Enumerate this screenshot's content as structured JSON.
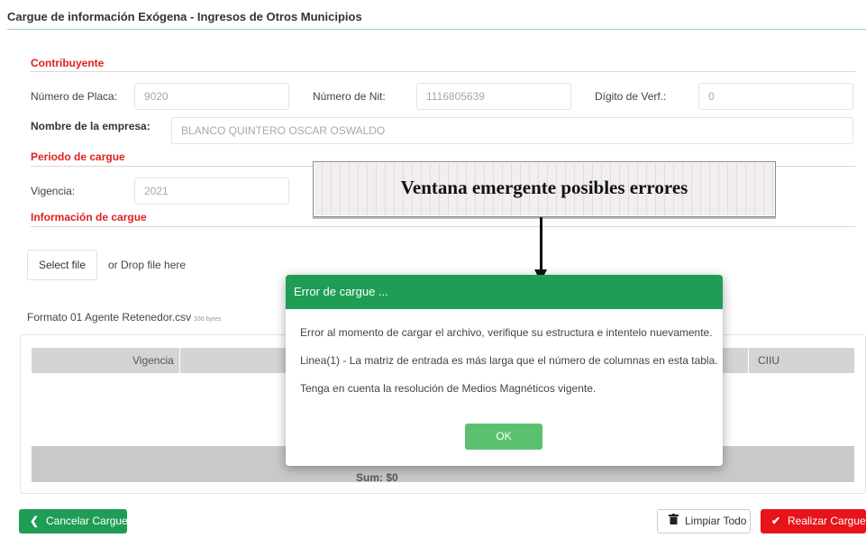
{
  "page": {
    "title": "Cargue de información Exógena - Ingresos de Otros Municipios"
  },
  "sections": {
    "contribuyente": "Contribuyente",
    "periodo": "Periodo de cargue",
    "informacion": "Información de cargue"
  },
  "contribuyente": {
    "placa_label": "Número de Placa:",
    "placa_value": "9020",
    "nit_label": "Número de Nit:",
    "nit_value": "1116805639",
    "digito_label": "Dígito de Verf.:",
    "digito_value": "0",
    "empresa_label": "Nombre de la empresa:",
    "empresa_value": "BLANCO QUINTERO OSCAR OSWALDO"
  },
  "periodo": {
    "vigencia_label": "Vigencia:",
    "vigencia_value": "2021"
  },
  "upload": {
    "select_label": "Select file",
    "drop_label": "or Drop file here",
    "filename": "Formato 01 Agente Retenedor.csv",
    "filesize": "336 bytes"
  },
  "table": {
    "columns": [
      "Vigencia",
      "CIIU"
    ],
    "footer": "Sum: $0"
  },
  "buttons": {
    "cancel": "Cancelar Cargue",
    "clear": "Limpiar Todo",
    "submit": "Realizar Cargue"
  },
  "icons": {
    "cancel": "chevron-left-icon",
    "clear": "trash-icon",
    "submit": "check-icon"
  },
  "callout": {
    "text": "Ventana emergente posibles errores"
  },
  "modal": {
    "title": "Error de cargue ...",
    "lines": [
      "Error al momento de cargar el archivo, verifique su estructura e intentelo nuevamente.",
      "Linea(1) - La matriz de entrada es más larga que el número de columnas en esta tabla.",
      "Tenga en cuenta la resolución de Medios Magnéticos vigente."
    ],
    "ok_label": "OK"
  },
  "colors": {
    "accent_green": "#1f9d55",
    "danger_red": "#e8141b",
    "section_red": "#e02020",
    "ok_green": "#5cc16e"
  }
}
